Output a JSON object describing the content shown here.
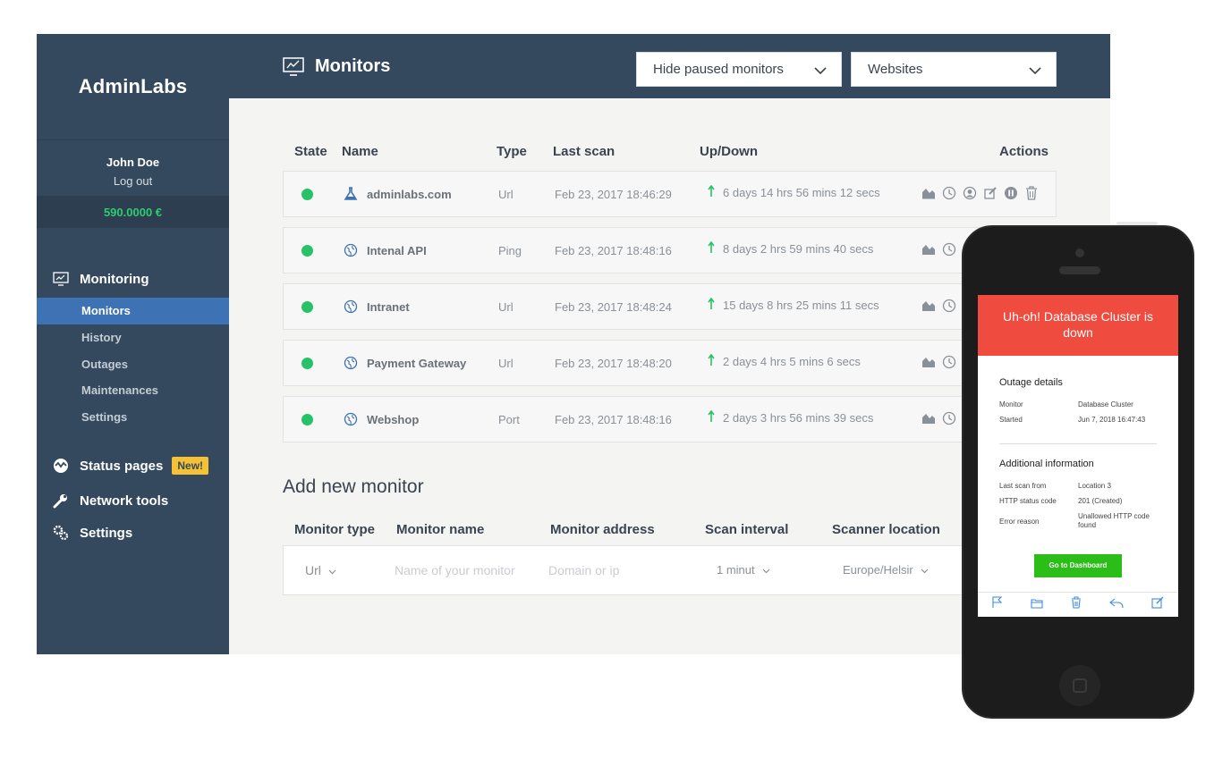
{
  "app": {
    "logo": "AdminLabs"
  },
  "user": {
    "name": "John Doe",
    "logout": "Log out",
    "balance": "590.0000 €"
  },
  "nav": {
    "monitoring": "Monitoring",
    "sub": [
      "Monitors",
      "History",
      "Outages",
      "Maintenances",
      "Settings"
    ],
    "status_pages": "Status pages",
    "new_badge": "New!",
    "network_tools": "Network tools",
    "settings": "Settings"
  },
  "header": {
    "title": "Monitors",
    "filter_paused": "Hide paused monitors",
    "filter_type": "Websites"
  },
  "table": {
    "headers": [
      "State",
      "Name",
      "Type",
      "Last scan",
      "Up/Down",
      "Actions"
    ],
    "rows": [
      {
        "name": "adminlabs.com",
        "type": "Url",
        "last_scan": "Feb 23, 2017 18:46:29",
        "uptime": "6 days 14 hrs 56 mins 12 secs",
        "icon": "flask-icon"
      },
      {
        "name": "Intenal API",
        "type": "Ping",
        "last_scan": "Feb 23, 2017 18:48:16",
        "uptime": "8 days 2 hrs 59 mins 40 secs",
        "icon": "globe-icon"
      },
      {
        "name": "Intranet",
        "type": "Url",
        "last_scan": "Feb 23, 2017 18:48:24",
        "uptime": "15 days 8 hrs 25 mins 11 secs",
        "icon": "globe-icon"
      },
      {
        "name": "Payment Gateway",
        "type": "Url",
        "last_scan": "Feb 23, 2017 18:48:20",
        "uptime": "2 days 4 hrs 5 mins 6 secs",
        "icon": "globe-icon"
      },
      {
        "name": "Webshop",
        "type": "Port",
        "last_scan": "Feb 23, 2017 18:48:16",
        "uptime": "2 days 3 hrs 56 mins 39 secs",
        "icon": "globe-icon"
      }
    ]
  },
  "add_monitor": {
    "title": "Add new monitor",
    "headers": [
      "Monitor type",
      "Monitor name",
      "Monitor address",
      "Scan interval",
      "Scanner location"
    ],
    "type_value": "Url",
    "name_placeholder": "Name of your monitor",
    "address_placeholder": "Domain or ip",
    "interval_value": "1 minut",
    "location_value": "Europe/Helsir"
  },
  "phone_alert": {
    "headline": "Uh-oh! Database Cluster is down",
    "outage_title": "Outage details",
    "monitor_label": "Monitor",
    "monitor_value": "Database Cluster",
    "started_label": "Started",
    "started_value": "Jun 7, 2018 16:47:43",
    "additional_title": "Additional information",
    "last_scan_label": "Last scan from",
    "last_scan_value": "Location 3",
    "http_label": "HTTP status code",
    "http_value": "201 (Created)",
    "error_label": "Error reason",
    "error_value": "Unallowed HTTP code found",
    "button": "Go to Dashboard"
  },
  "colors": {
    "sidebar": "#34495e",
    "active": "#3d72b4",
    "up": "#27c267",
    "alert": "#ef4b3e",
    "cta": "#2bbd18"
  }
}
